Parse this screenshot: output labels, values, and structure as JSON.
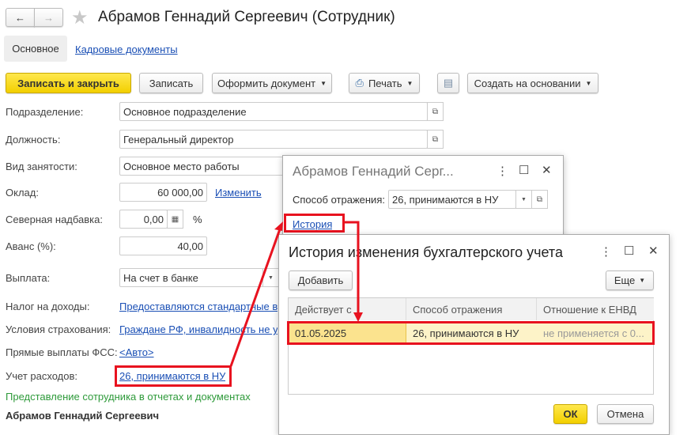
{
  "window": {
    "title": "Абрамов Геннадий Сергеевич (Сотрудник)"
  },
  "tabs": [
    {
      "label": "Основное"
    },
    {
      "label": "Кадровые документы"
    }
  ],
  "toolbar": {
    "save_close": "Записать и закрыть",
    "save": "Записать",
    "create_doc": "Оформить документ",
    "print": "Печать",
    "create_based": "Создать на основании"
  },
  "form": {
    "department": {
      "label": "Подразделение:",
      "value": "Основное подразделение"
    },
    "position": {
      "label": "Должность:",
      "value": "Генеральный директор"
    },
    "employment": {
      "label": "Вид занятости:",
      "value": "Основное место работы"
    },
    "salary": {
      "label": "Оклад:",
      "value": "60 000,00",
      "link": "Изменить"
    },
    "north": {
      "label": "Северная надбавка:",
      "value": "0,00",
      "unit": "%"
    },
    "advance": {
      "label": "Аванс (%):",
      "value": "40,00"
    },
    "payment": {
      "label": "Выплата:",
      "value": "На счет в банке"
    },
    "tax": {
      "label": "Налог на доходы:",
      "value": "Предоставляются стандартные вычеты"
    },
    "insurance": {
      "label": "Условия страхования:",
      "value": "Граждане РФ, инвалидность не установлена"
    },
    "fss": {
      "label": "Прямые выплаты ФСС:",
      "value": "<Авто>"
    },
    "expenses": {
      "label": "Учет расходов:",
      "value": "26, принимаются в НУ"
    },
    "section": "Представление сотрудника в отчетах и документах",
    "name": "Абрамов Геннадий Сергеевич"
  },
  "dialog1": {
    "title": "Абрамов Геннадий Серг...",
    "method_label": "Способ отражения:",
    "method_value": "26, принимаются в НУ",
    "history": "История"
  },
  "dialog2": {
    "title": "История изменения бухгалтерского учета",
    "add": "Добавить",
    "more": "Еще",
    "columns": [
      "Действует с",
      "Способ отражения",
      "Отношение к ЕНВД"
    ],
    "rows": [
      [
        "01.05.2025",
        "26, принимаются в НУ",
        "не применяется с 0..."
      ]
    ],
    "ok": "ОК",
    "cancel": "Отмена"
  },
  "colors": {
    "accent": "#f2cf00",
    "highlight": "#e8121f",
    "link": "#1a4fb5",
    "green": "#2e9a3a"
  }
}
